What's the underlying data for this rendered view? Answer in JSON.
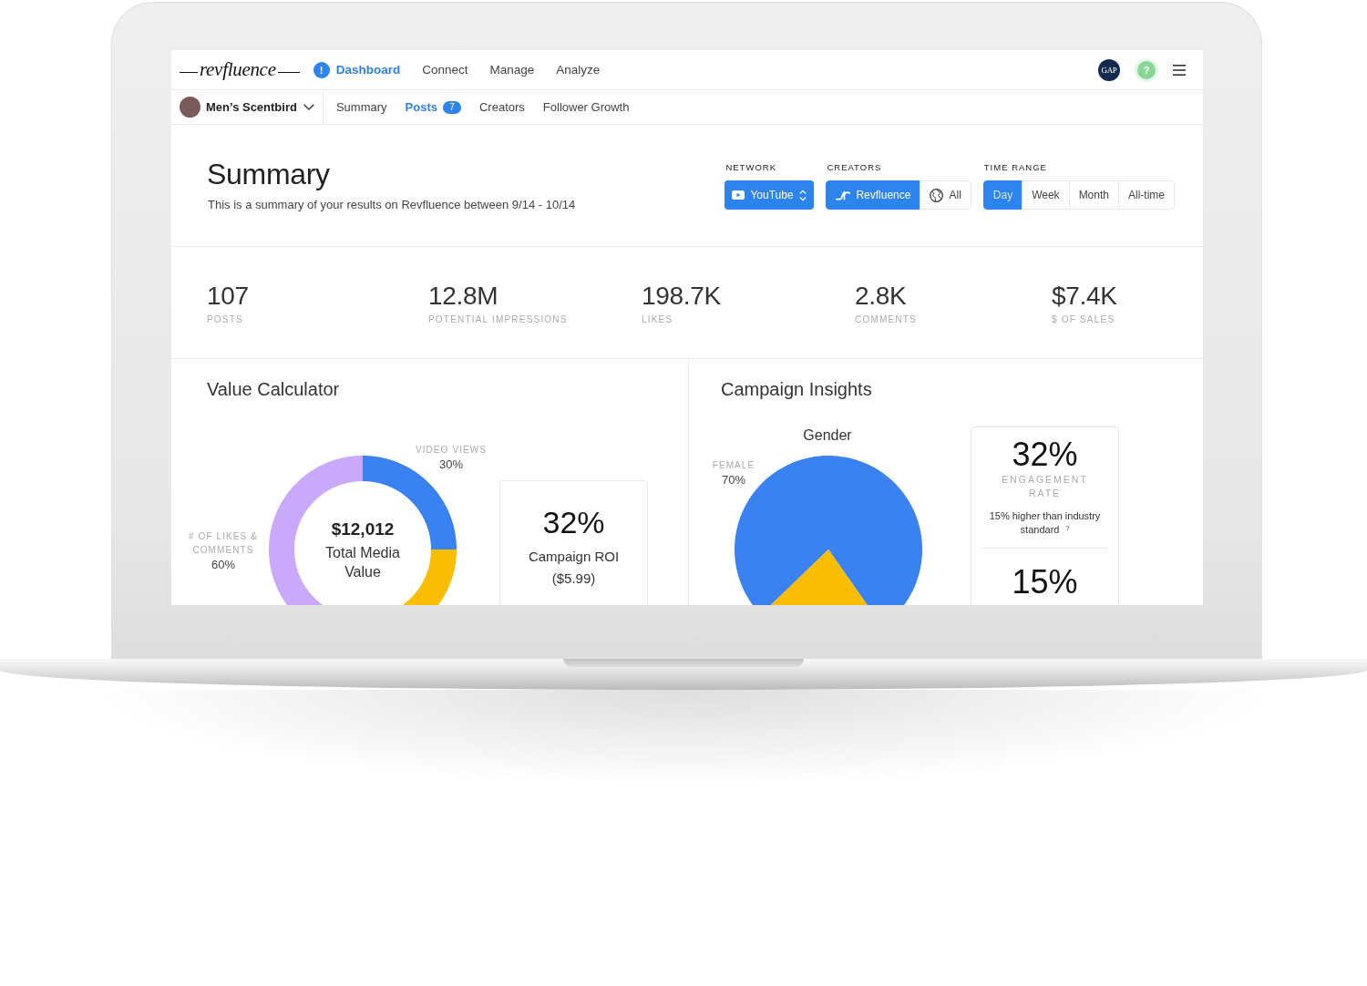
{
  "top_nav": {
    "logo": "revfluence",
    "items": [
      {
        "label": "Dashboard",
        "selected": true,
        "badge": "!"
      },
      {
        "label": "Connect",
        "selected": false
      },
      {
        "label": "Manage",
        "selected": false
      },
      {
        "label": "Analyze",
        "selected": false
      }
    ],
    "account": "GAP",
    "help": "?"
  },
  "sub_nav": {
    "brand": "Men’s Scentbird",
    "tabs": [
      {
        "label": "Summary",
        "selected": false
      },
      {
        "label": "Posts",
        "selected": true,
        "count": "7"
      },
      {
        "label": "Creators",
        "selected": false
      },
      {
        "label": "Follower Growth",
        "selected": false
      }
    ]
  },
  "header": {
    "title": "Summary",
    "subtitle": "This is a summary of your results on Revfluence between 9/14 - 10/14"
  },
  "filters": {
    "network": {
      "label": "NETWORK",
      "value": "YouTube"
    },
    "creators": {
      "label": "CREATORS",
      "options": [
        {
          "label": "Revfluence",
          "selected": true
        },
        {
          "label": "All",
          "selected": false
        }
      ]
    },
    "time_range": {
      "label": "TIME RANGE",
      "options": [
        {
          "label": "Day",
          "selected": true
        },
        {
          "label": "Week",
          "selected": false
        },
        {
          "label": "Month",
          "selected": false
        },
        {
          "label": "All-time",
          "selected": false
        }
      ]
    }
  },
  "stats": [
    {
      "value": "107",
      "label": "POSTS"
    },
    {
      "value": "12.8M",
      "label": "POTENTIAL IMPRESSIONS"
    },
    {
      "value": "198.7K",
      "label": "LIKES"
    },
    {
      "value": "2.8K",
      "label": "COMMENTS"
    },
    {
      "value": "$7.4K",
      "label": "$ OF SALES"
    }
  ],
  "value_calculator": {
    "title": "Value Calculator",
    "donut": {
      "labels": [
        {
          "name": "VIDEO VIEWS",
          "share": "30%"
        },
        {
          "name": "# OF LIKES & COMMENTS",
          "share": "60%"
        }
      ],
      "total": "$12,012",
      "total_label": "Total Media Value"
    },
    "roi": {
      "value": "32%",
      "label": "Campaign ROI",
      "amount": "($5.99)"
    }
  },
  "campaign_insights": {
    "title": "Campaign Insights",
    "gender": {
      "title": "Gender",
      "labels": [
        {
          "name": "FEMALE",
          "share": "70%"
        }
      ]
    },
    "metrics": [
      {
        "value": "32%",
        "label": "ENGAGEMENT RATE",
        "note": "15% higher than industry standard $^{?}$"
      },
      {
        "value": "15%"
      }
    ]
  }
}
